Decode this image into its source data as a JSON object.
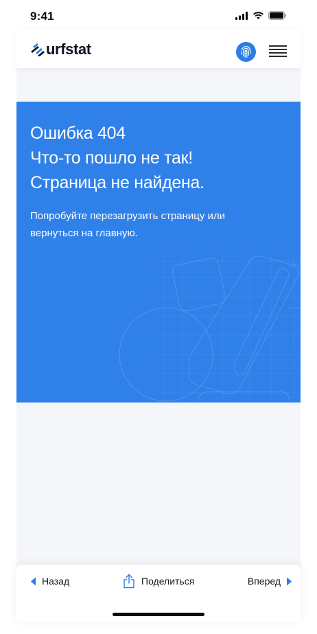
{
  "status_bar": {
    "time": "9:41"
  },
  "header": {
    "logo_text": "urfstat",
    "brand_color": "#2c7ee6"
  },
  "hero": {
    "background": "#2f80e8",
    "title_lines": [
      "Ошибка 404",
      "Что-то пошло не так!",
      "Страница не найдена."
    ],
    "subtitle": "Попробуйте перезагрузить страницу или вернуться на главную."
  },
  "bottom_nav": {
    "back_label": "Назад",
    "share_label": "Поделиться",
    "forward_label": "Вперед"
  },
  "icons": {
    "status": [
      "signal-icon",
      "wifi-icon",
      "battery-icon"
    ],
    "header": [
      "fingerprint-icon",
      "hamburger-menu-icon"
    ],
    "nav": [
      "back-arrow-icon",
      "share-icon",
      "forward-arrow-icon"
    ]
  }
}
